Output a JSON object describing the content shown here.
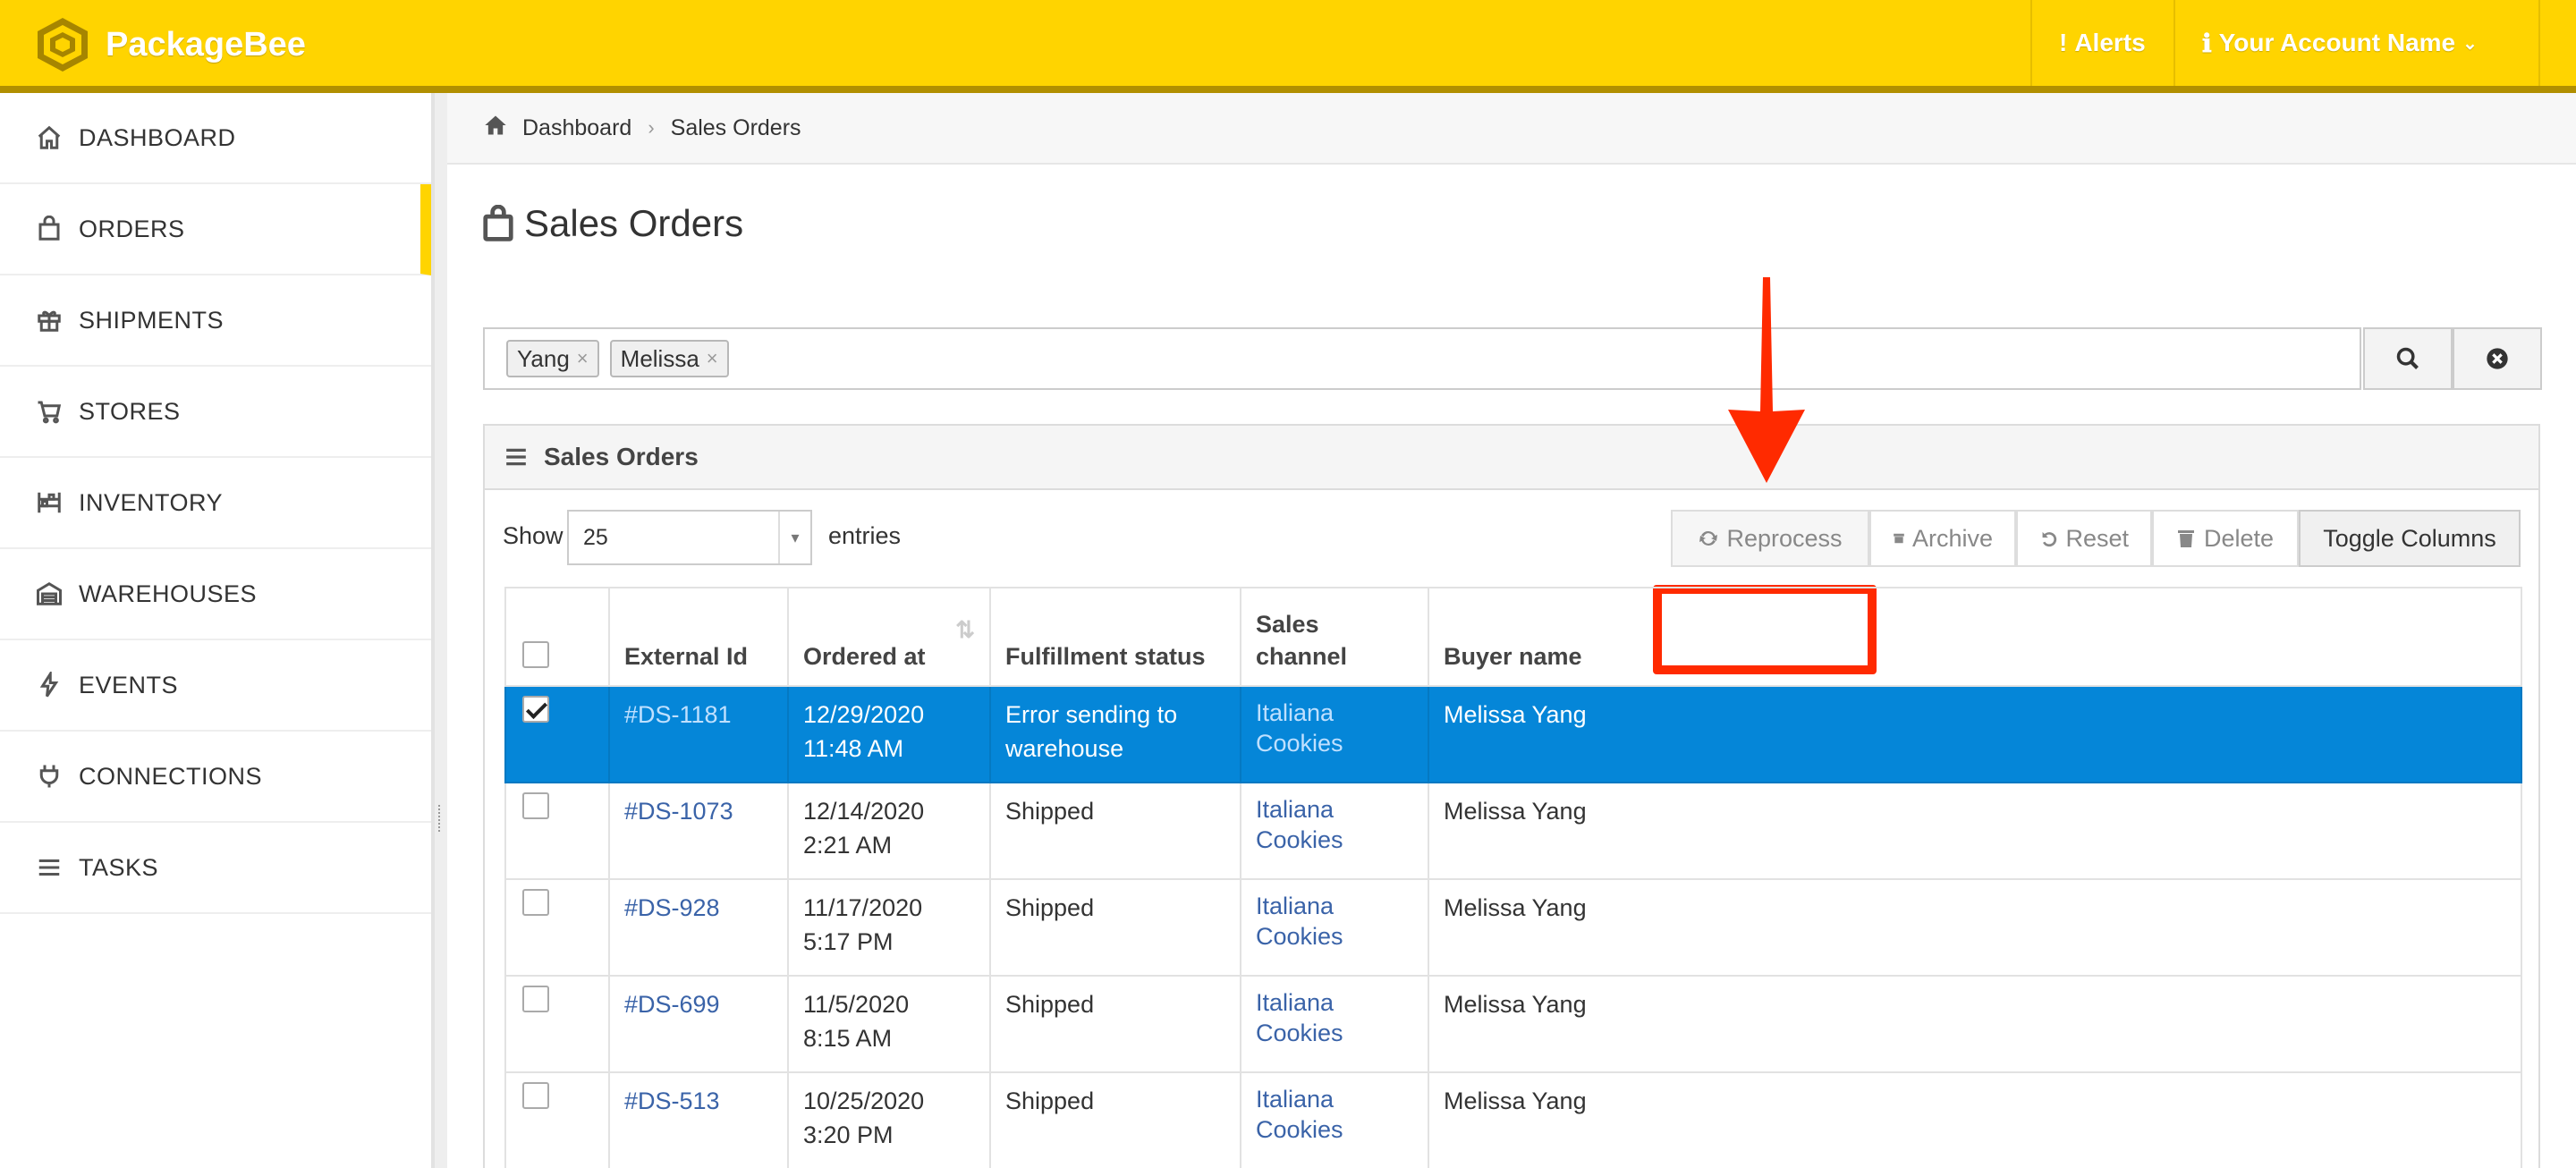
{
  "header": {
    "brand": "PackageBee",
    "alerts_label": "Alerts",
    "account_label": "Your Account Name",
    "accent_color": "#ffd400"
  },
  "sidebar": {
    "items": [
      {
        "label": "DASHBOARD",
        "icon": "home-icon"
      },
      {
        "label": "ORDERS",
        "icon": "shopping-bag-icon",
        "active": true
      },
      {
        "label": "SHIPMENTS",
        "icon": "gift-icon"
      },
      {
        "label": "STORES",
        "icon": "cart-icon"
      },
      {
        "label": "INVENTORY",
        "icon": "shelves-icon"
      },
      {
        "label": "WAREHOUSES",
        "icon": "warehouse-icon"
      },
      {
        "label": "EVENTS",
        "icon": "bolt-icon"
      },
      {
        "label": "CONNECTIONS",
        "icon": "plug-icon"
      },
      {
        "label": "TASKS",
        "icon": "list-icon"
      }
    ]
  },
  "breadcrumb": {
    "home": "Dashboard",
    "current": "Sales Orders"
  },
  "page": {
    "title": "Sales Orders"
  },
  "search": {
    "tags": [
      "Yang",
      "Melissa"
    ]
  },
  "panel": {
    "title": "Sales Orders",
    "show_label": "Show",
    "entries_value": "25",
    "entries_label": "entries",
    "buttons": {
      "reprocess": "Reprocess",
      "archive": "Archive",
      "reset": "Reset",
      "delete": "Delete",
      "toggle": "Toggle Columns"
    }
  },
  "table": {
    "columns": [
      "External Id",
      "Ordered at",
      "Fulfillment status",
      "Sales channel",
      "Buyer name"
    ],
    "rows": [
      {
        "id": "#DS-1181",
        "date": "12/29/2020",
        "time": "11:48 AM",
        "status": "Error sending to warehouse",
        "channel": "Italiana Cookies",
        "buyer": "Melissa Yang",
        "selected": true
      },
      {
        "id": "#DS-1073",
        "date": "12/14/2020",
        "time": "2:21 AM",
        "status": "Shipped",
        "channel": "Italiana Cookies",
        "buyer": "Melissa Yang"
      },
      {
        "id": "#DS-928",
        "date": "11/17/2020",
        "time": "5:17 PM",
        "status": "Shipped",
        "channel": "Italiana Cookies",
        "buyer": "Melissa Yang"
      },
      {
        "id": "#DS-699",
        "date": "11/5/2020",
        "time": "8:15 AM",
        "status": "Shipped",
        "channel": "Italiana Cookies",
        "buyer": "Melissa Yang"
      },
      {
        "id": "#DS-513",
        "date": "10/25/2020",
        "time": "3:20 PM",
        "status": "Shipped",
        "channel": "Italiana Cookies",
        "buyer": "Melissa Yang"
      }
    ]
  },
  "annotation": {
    "color": "#ff2a00"
  }
}
